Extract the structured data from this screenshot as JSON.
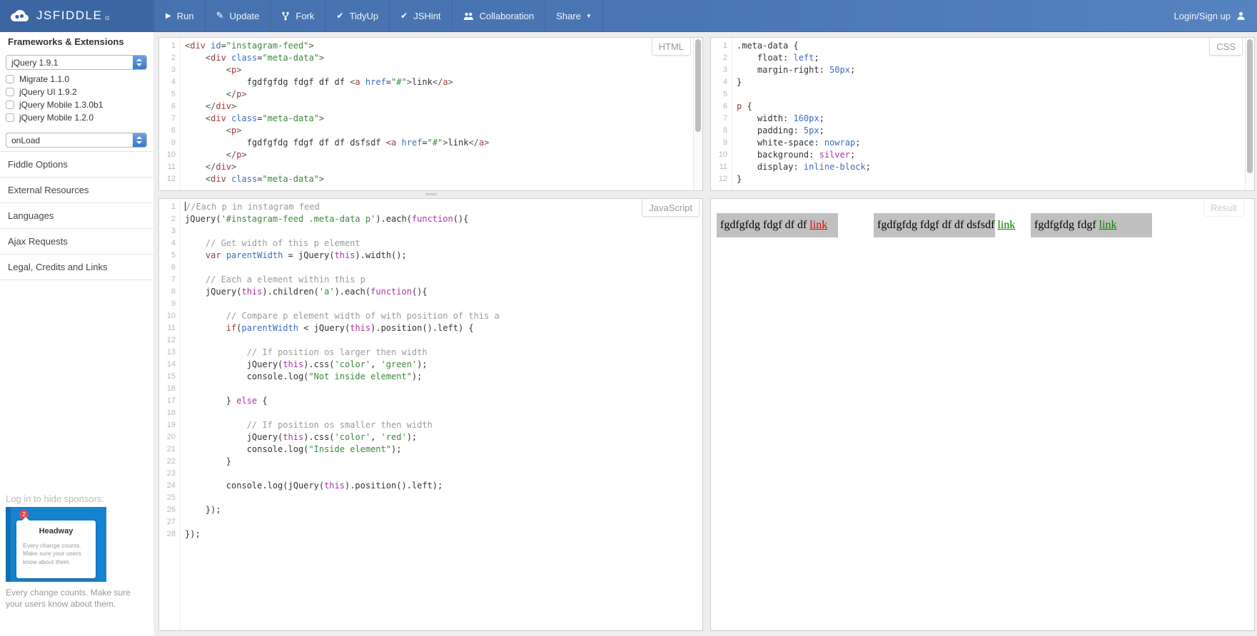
{
  "navbar": {
    "logo_text": "JSFIDDLE",
    "logo_alpha": "α",
    "buttons": [
      {
        "icon": "play",
        "label": "Run"
      },
      {
        "icon": "pencil",
        "label": "Update"
      },
      {
        "icon": "fork",
        "label": "Fork"
      },
      {
        "icon": "check",
        "label": "TidyUp"
      },
      {
        "icon": "check",
        "label": "JSHint"
      },
      {
        "icon": "people",
        "label": "Collaboration"
      },
      {
        "icon": "",
        "label": "Share",
        "caret": true
      }
    ],
    "login_label": "Login/Sign up"
  },
  "sidebar": {
    "frameworks_heading": "Frameworks & Extensions",
    "framework_select": "jQuery 1.9.1",
    "onload_select": "onLoad",
    "extensions": [
      "Migrate 1.1.0",
      "jQuery UI 1.9.2",
      "jQuery Mobile 1.3.0b1",
      "jQuery Mobile 1.2.0"
    ],
    "sections": [
      "Fiddle Options",
      "External Resources",
      "Languages",
      "Ajax Requests",
      "Legal, Credits and Links"
    ],
    "sponsor_note": "Log in to hide sponsors:",
    "ad": {
      "badge": "2",
      "title": "Headway",
      "body": "Every change counts. Make sure your users know about them."
    },
    "ad_caption": "Every change counts. Make sure your users know about them."
  },
  "editors": {
    "html": {
      "label": "HTML",
      "lines": [
        [
          [
            "pu",
            "<"
          ],
          [
            "tg",
            "div"
          ],
          [
            "pl",
            " "
          ],
          [
            "at",
            "id"
          ],
          [
            "pl",
            "="
          ],
          [
            "st",
            "\"instagram-feed\""
          ],
          [
            "pu",
            ">"
          ]
        ],
        [
          [
            "pl",
            "    "
          ],
          [
            "pu",
            "<"
          ],
          [
            "tg",
            "div"
          ],
          [
            "pl",
            " "
          ],
          [
            "at",
            "class"
          ],
          [
            "pl",
            "="
          ],
          [
            "st",
            "\"meta-data\""
          ],
          [
            "pu",
            ">"
          ]
        ],
        [
          [
            "pl",
            "        "
          ],
          [
            "pu",
            "<"
          ],
          [
            "tg",
            "p"
          ],
          [
            "pu",
            ">"
          ]
        ],
        [
          [
            "pl",
            "            fgdfgfdg fdgf df df "
          ],
          [
            "pu",
            "<"
          ],
          [
            "tg",
            "a"
          ],
          [
            "pl",
            " "
          ],
          [
            "at",
            "href"
          ],
          [
            "pl",
            "="
          ],
          [
            "st",
            "\"#\""
          ],
          [
            "pu",
            ">"
          ],
          [
            "pl",
            "link"
          ],
          [
            "pu",
            "</"
          ],
          [
            "tg",
            "a"
          ],
          [
            "pu",
            ">"
          ]
        ],
        [
          [
            "pl",
            "        "
          ],
          [
            "pu",
            "</"
          ],
          [
            "tg",
            "p"
          ],
          [
            "pu",
            ">"
          ]
        ],
        [
          [
            "pl",
            "    "
          ],
          [
            "pu",
            "</"
          ],
          [
            "tg",
            "div"
          ],
          [
            "pu",
            ">"
          ]
        ],
        [
          [
            "pl",
            "    "
          ],
          [
            "pu",
            "<"
          ],
          [
            "tg",
            "div"
          ],
          [
            "pl",
            " "
          ],
          [
            "at",
            "class"
          ],
          [
            "pl",
            "="
          ],
          [
            "st",
            "\"meta-data\""
          ],
          [
            "pu",
            ">"
          ]
        ],
        [
          [
            "pl",
            "        "
          ],
          [
            "pu",
            "<"
          ],
          [
            "tg",
            "p"
          ],
          [
            "pu",
            ">"
          ]
        ],
        [
          [
            "pl",
            "            fgdfgfdg fdgf df df dsfsdf "
          ],
          [
            "pu",
            "<"
          ],
          [
            "tg",
            "a"
          ],
          [
            "pl",
            " "
          ],
          [
            "at",
            "href"
          ],
          [
            "pl",
            "="
          ],
          [
            "st",
            "\"#\""
          ],
          [
            "pu",
            ">"
          ],
          [
            "pl",
            "link"
          ],
          [
            "pu",
            "</"
          ],
          [
            "tg",
            "a"
          ],
          [
            "pu",
            ">"
          ]
        ],
        [
          [
            "pl",
            "        "
          ],
          [
            "pu",
            "</"
          ],
          [
            "tg",
            "p"
          ],
          [
            "pu",
            ">"
          ]
        ],
        [
          [
            "pl",
            "    "
          ],
          [
            "pu",
            "</"
          ],
          [
            "tg",
            "div"
          ],
          [
            "pu",
            ">"
          ]
        ],
        [
          [
            "pl",
            "    "
          ],
          [
            "pu",
            "<"
          ],
          [
            "tg",
            "div"
          ],
          [
            "pl",
            " "
          ],
          [
            "at",
            "class"
          ],
          [
            "pl",
            "="
          ],
          [
            "st",
            "\"meta-data\""
          ],
          [
            "pu",
            ">"
          ]
        ]
      ]
    },
    "css": {
      "label": "CSS",
      "lines": [
        [
          [
            "pl",
            ".meta-data {"
          ]
        ],
        [
          [
            "pl",
            "    float: "
          ],
          [
            "vr",
            "left"
          ],
          [
            "pl",
            ";"
          ]
        ],
        [
          [
            "pl",
            "    margin-right: "
          ],
          [
            "vr",
            "50px"
          ],
          [
            "pl",
            ";"
          ]
        ],
        [
          [
            "pl",
            "}"
          ]
        ],
        [],
        [
          [
            "tg",
            "p"
          ],
          [
            "pl",
            " {"
          ]
        ],
        [
          [
            "pl",
            "    width: "
          ],
          [
            "vr",
            "160px"
          ],
          [
            "pl",
            ";"
          ]
        ],
        [
          [
            "pl",
            "    padding: "
          ],
          [
            "vr",
            "5px"
          ],
          [
            "pl",
            ";"
          ]
        ],
        [
          [
            "pl",
            "    white-space: "
          ],
          [
            "vr",
            "nowrap"
          ],
          [
            "pl",
            ";"
          ]
        ],
        [
          [
            "pl",
            "    background: "
          ],
          [
            "k2",
            "silver"
          ],
          [
            "pl",
            ";"
          ]
        ],
        [
          [
            "pl",
            "    display: "
          ],
          [
            "vr",
            "inline-block"
          ],
          [
            "pl",
            ";"
          ]
        ],
        [
          [
            "pl",
            "}"
          ]
        ]
      ]
    },
    "js": {
      "label": "JavaScript",
      "caret_line": 1,
      "lines": [
        [
          [
            "cm",
            "//Each p in instagram feed"
          ]
        ],
        [
          [
            "pl",
            "jQuery("
          ],
          [
            "st",
            "'#instagram-feed .meta-data p'"
          ],
          [
            "pl",
            ").each("
          ],
          [
            "k2",
            "function"
          ],
          [
            "pl",
            "(){"
          ]
        ],
        [],
        [
          [
            "pl",
            "    "
          ],
          [
            "cm",
            "// Get width of this p element"
          ]
        ],
        [
          [
            "pl",
            "    "
          ],
          [
            "kw",
            "var"
          ],
          [
            "pl",
            " "
          ],
          [
            "vr",
            "parentWidth"
          ],
          [
            "pl",
            " = jQuery("
          ],
          [
            "k2",
            "this"
          ],
          [
            "pl",
            ").width();"
          ]
        ],
        [],
        [
          [
            "pl",
            "    "
          ],
          [
            "cm",
            "// Each a element within this p"
          ]
        ],
        [
          [
            "pl",
            "    jQuery("
          ],
          [
            "k2",
            "this"
          ],
          [
            "pl",
            ").children("
          ],
          [
            "st",
            "'a'"
          ],
          [
            "pl",
            ").each("
          ],
          [
            "k2",
            "function"
          ],
          [
            "pl",
            "(){"
          ]
        ],
        [],
        [
          [
            "pl",
            "        "
          ],
          [
            "cm",
            "// Compare p element width of with position of this a"
          ]
        ],
        [
          [
            "pl",
            "        "
          ],
          [
            "kw",
            "if"
          ],
          [
            "pl",
            "("
          ],
          [
            "vr",
            "parentWidth"
          ],
          [
            "pl",
            " < jQuery("
          ],
          [
            "k2",
            "this"
          ],
          [
            "pl",
            ").position().left) {"
          ]
        ],
        [],
        [
          [
            "pl",
            "            "
          ],
          [
            "cm",
            "// If position os larger then width"
          ]
        ],
        [
          [
            "pl",
            "            jQuery("
          ],
          [
            "k2",
            "this"
          ],
          [
            "pl",
            ").css("
          ],
          [
            "st",
            "'color'"
          ],
          [
            "pl",
            ", "
          ],
          [
            "st",
            "'green'"
          ],
          [
            "pl",
            ");"
          ]
        ],
        [
          [
            "pl",
            "            console.log("
          ],
          [
            "st",
            "\"Not inside element\""
          ],
          [
            "pl",
            ");"
          ]
        ],
        [],
        [
          [
            "pl",
            "        } "
          ],
          [
            "k2",
            "else"
          ],
          [
            "pl",
            " {"
          ]
        ],
        [],
        [
          [
            "pl",
            "            "
          ],
          [
            "cm",
            "// If position os smaller then width"
          ]
        ],
        [
          [
            "pl",
            "            jQuery("
          ],
          [
            "k2",
            "this"
          ],
          [
            "pl",
            ").css("
          ],
          [
            "st",
            "'color'"
          ],
          [
            "pl",
            ", "
          ],
          [
            "st",
            "'red'"
          ],
          [
            "pl",
            ");"
          ]
        ],
        [
          [
            "pl",
            "            console.log("
          ],
          [
            "st",
            "\"Inside element\""
          ],
          [
            "pl",
            ");"
          ]
        ],
        [
          [
            "pl",
            "        }"
          ]
        ],
        [],
        [
          [
            "pl",
            "        console.log(jQuery("
          ],
          [
            "k2",
            "this"
          ],
          [
            "pl",
            ").position().left);"
          ]
        ],
        [],
        [
          [
            "pl",
            "    });"
          ]
        ],
        [],
        [
          [
            "pl",
            "});"
          ]
        ]
      ]
    }
  },
  "result": {
    "label": "Result",
    "boxes": [
      {
        "text": "fgdfgfdg fdgf df df ",
        "link_text": "link",
        "link_color": "#e60000"
      },
      {
        "text": "fgdfgfdg fdgf df df dsfsdf ",
        "link_text": "link",
        "link_color": "#008000"
      },
      {
        "text": "fgdfgfdg fdgf ",
        "link_text": "link",
        "link_color": "#008000"
      }
    ]
  },
  "colors": {
    "navbar_blue": "#4a77b4",
    "logo_block_blue": "#3c66a2",
    "result_box_silver": "#c0c0c0",
    "link_red": "#e60000",
    "link_green": "#008000",
    "ad_blue": "#1583d0"
  }
}
